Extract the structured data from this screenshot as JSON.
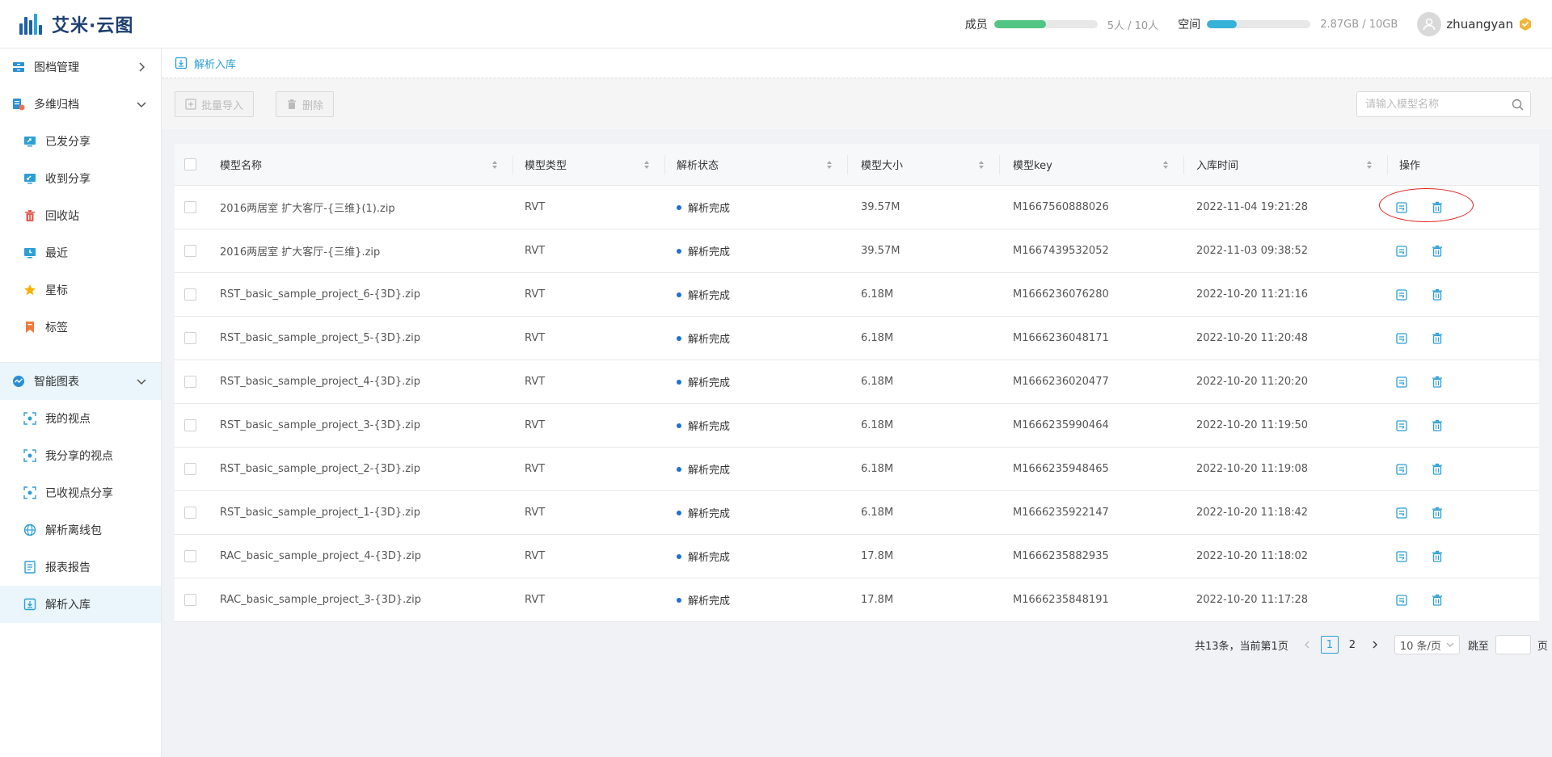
{
  "app": {
    "title": "艾米·云图"
  },
  "header": {
    "members_label": "成员",
    "members_value": "5人 / 10人",
    "members_fill": 0.5,
    "members_color": "#52c483",
    "space_label": "空间",
    "space_value": "2.87GB / 10GB",
    "space_fill": 0.287,
    "space_color": "#36b1d8",
    "username": "zhuangyan"
  },
  "sidebar": {
    "archive": "图档管理",
    "multi": "多维归档",
    "multi_items": [
      "已发分享",
      "收到分享",
      "回收站",
      "最近",
      "星标",
      "标签"
    ],
    "smart": "智能图表",
    "smart_items": [
      "我的视点",
      "我分享的视点",
      "已收视点分享",
      "解析离线包",
      "报表报告",
      "解析入库"
    ]
  },
  "breadcrumb": {
    "current": "解析入库"
  },
  "toolbar": {
    "batch_import": "批量导入",
    "delete": "删除",
    "search_placeholder": "请输入模型名称"
  },
  "table": {
    "columns": [
      "模型名称",
      "模型类型",
      "解析状态",
      "模型大小",
      "模型key",
      "入库时间",
      "操作"
    ],
    "rows": [
      {
        "name": "2016两居室 扩大客厅-{三维}(1).zip",
        "type": "RVT",
        "status": "解析完成",
        "size": "39.57M",
        "key": "M1667560888026",
        "time": "2022-11-04 19:21:28"
      },
      {
        "name": "2016两居室 扩大客厅-{三维}.zip",
        "type": "RVT",
        "status": "解析完成",
        "size": "39.57M",
        "key": "M1667439532052",
        "time": "2022-11-03 09:38:52"
      },
      {
        "name": "RST_basic_sample_project_6-{3D}.zip",
        "type": "RVT",
        "status": "解析完成",
        "size": "6.18M",
        "key": "M1666236076280",
        "time": "2022-10-20 11:21:16"
      },
      {
        "name": "RST_basic_sample_project_5-{3D}.zip",
        "type": "RVT",
        "status": "解析完成",
        "size": "6.18M",
        "key": "M1666236048171",
        "time": "2022-10-20 11:20:48"
      },
      {
        "name": "RST_basic_sample_project_4-{3D}.zip",
        "type": "RVT",
        "status": "解析完成",
        "size": "6.18M",
        "key": "M1666236020477",
        "time": "2022-10-20 11:20:20"
      },
      {
        "name": "RST_basic_sample_project_3-{3D}.zip",
        "type": "RVT",
        "status": "解析完成",
        "size": "6.18M",
        "key": "M1666235990464",
        "time": "2022-10-20 11:19:50"
      },
      {
        "name": "RST_basic_sample_project_2-{3D}.zip",
        "type": "RVT",
        "status": "解析完成",
        "size": "6.18M",
        "key": "M1666235948465",
        "time": "2022-10-20 11:19:08"
      },
      {
        "name": "RST_basic_sample_project_1-{3D}.zip",
        "type": "RVT",
        "status": "解析完成",
        "size": "6.18M",
        "key": "M1666235922147",
        "time": "2022-10-20 11:18:42"
      },
      {
        "name": "RAC_basic_sample_project_4-{3D}.zip",
        "type": "RVT",
        "status": "解析完成",
        "size": "17.8M",
        "key": "M1666235882935",
        "time": "2022-10-20 11:18:02"
      },
      {
        "name": "RAC_basic_sample_project_3-{3D}.zip",
        "type": "RVT",
        "status": "解析完成",
        "size": "17.8M",
        "key": "M1666235848191",
        "time": "2022-10-20 11:17:28"
      }
    ]
  },
  "pagination": {
    "summary": "共13条，当前第1页",
    "pages": [
      "1",
      "2"
    ],
    "page_size": "10 条/页",
    "jump_label": "跳至",
    "page_suffix": "页"
  }
}
